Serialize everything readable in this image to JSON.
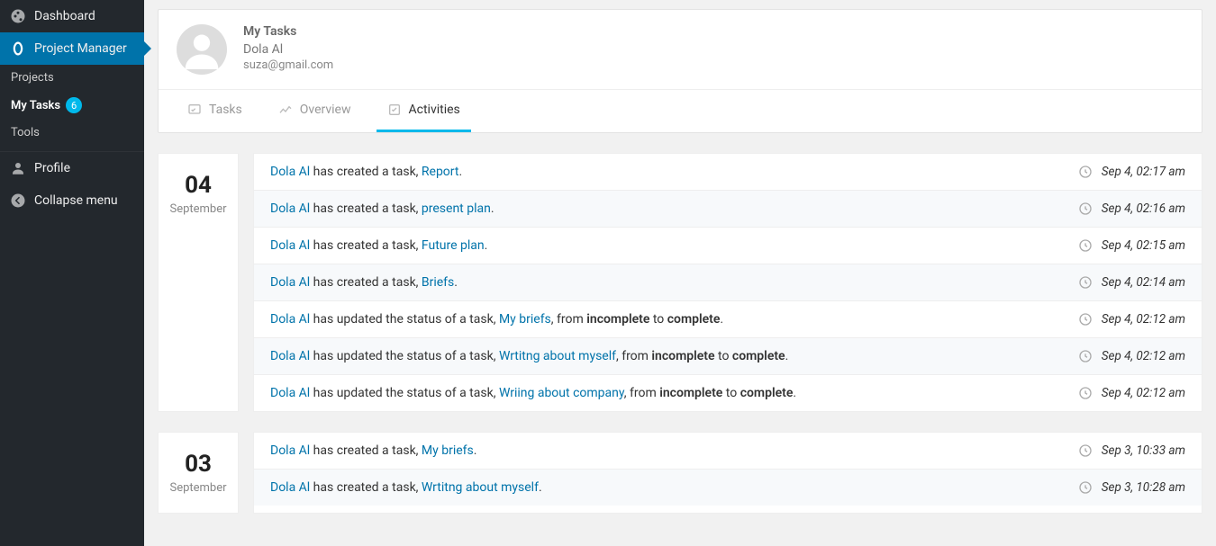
{
  "sidebar": {
    "dashboard": "Dashboard",
    "project_manager": "Project Manager",
    "projects": "Projects",
    "mytasks": "My Tasks",
    "mytasks_count": "6",
    "tools": "Tools",
    "profile": "Profile",
    "collapse": "Collapse menu"
  },
  "header": {
    "title": "My Tasks",
    "name": "Dola Al",
    "email": "suza@gmail.com"
  },
  "tabs": {
    "tasks": "Tasks",
    "overview": "Overview",
    "activities": "Activities"
  },
  "days": [
    {
      "num": "04",
      "month": "September",
      "items": [
        {
          "user": "Dola Al",
          "mid1": " has created a task, ",
          "link": "Report",
          "mid2": "",
          "status1": "",
          "mid3": "",
          "status2": "",
          "tail": ".",
          "time": "Sep 4, 02:17 am"
        },
        {
          "user": "Dola Al",
          "mid1": " has created a task, ",
          "link": "present plan",
          "mid2": "",
          "status1": "",
          "mid3": "",
          "status2": "",
          "tail": ".",
          "time": "Sep 4, 02:16 am"
        },
        {
          "user": "Dola Al",
          "mid1": " has created a task, ",
          "link": "Future plan",
          "mid2": "",
          "status1": "",
          "mid3": "",
          "status2": "",
          "tail": ".",
          "time": "Sep 4, 02:15 am"
        },
        {
          "user": "Dola Al",
          "mid1": " has created a task, ",
          "link": "Briefs",
          "mid2": "",
          "status1": "",
          "mid3": "",
          "status2": "",
          "tail": ".",
          "time": "Sep 4, 02:14 am"
        },
        {
          "user": "Dola Al",
          "mid1": " has updated the status of a task, ",
          "link": "My briefs",
          "mid2": ", from ",
          "status1": "incomplete",
          "mid3": " to ",
          "status2": "complete",
          "tail": ".",
          "time": "Sep 4, 02:12 am"
        },
        {
          "user": "Dola Al",
          "mid1": " has updated the status of a task, ",
          "link": "Wrtitng about myself",
          "mid2": ", from ",
          "status1": "incomplete",
          "mid3": " to ",
          "status2": "complete",
          "tail": ".",
          "time": "Sep 4, 02:12 am"
        },
        {
          "user": "Dola Al",
          "mid1": " has updated the status of a task, ",
          "link": "Wriing about company",
          "mid2": ", from ",
          "status1": "incomplete",
          "mid3": " to ",
          "status2": "complete",
          "tail": ".",
          "time": "Sep 4, 02:12 am"
        }
      ]
    },
    {
      "num": "03",
      "month": "September",
      "items": [
        {
          "user": "Dola Al",
          "mid1": " has created a task, ",
          "link": "My briefs",
          "mid2": "",
          "status1": "",
          "mid3": "",
          "status2": "",
          "tail": ".",
          "time": "Sep 3, 10:33 am"
        },
        {
          "user": "Dola Al",
          "mid1": " has created a task, ",
          "link": "Wrtitng about myself",
          "mid2": "",
          "status1": "",
          "mid3": "",
          "status2": "",
          "tail": ".",
          "time": "Sep 3, 10:28 am"
        }
      ]
    }
  ]
}
